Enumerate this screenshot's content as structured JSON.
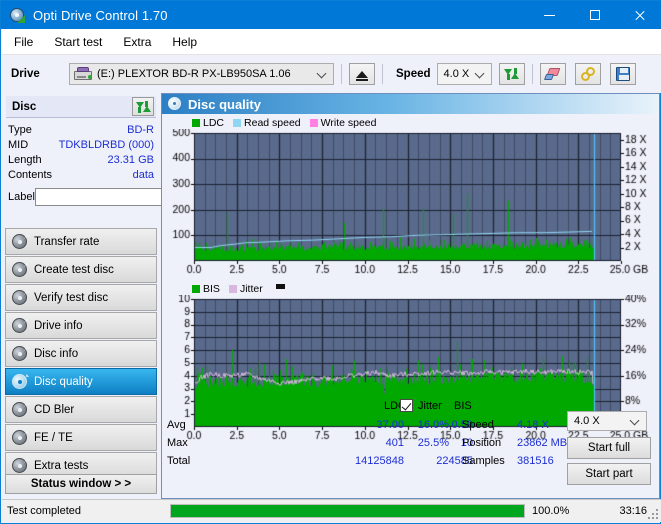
{
  "window": {
    "title": "Opti Drive Control 1.70",
    "icon": "disc-drive-icon",
    "minimize": "minimize",
    "maximize": "maximize",
    "close": "close"
  },
  "menu": {
    "items": [
      {
        "label": "File"
      },
      {
        "label": "Start test"
      },
      {
        "label": "Extra"
      },
      {
        "label": "Help"
      }
    ]
  },
  "toolbar": {
    "drive_label": "Drive",
    "drive_value": "(E:)   PLEXTOR BD-R  PX-LB950SA 1.06",
    "eject_label": "eject",
    "speed_label": "Speed",
    "speed_value": "4.0 X",
    "refresh_label": "refresh",
    "erase_label": "erase",
    "key_label": "key",
    "save_label": "save"
  },
  "disc": {
    "header": "Disc",
    "refresh_label": "refresh",
    "rows": [
      {
        "key": "Type",
        "value": "BD-R"
      },
      {
        "key": "MID",
        "value": "TDKBLDRBD (000)"
      },
      {
        "key": "Length",
        "value": "23.31 GB"
      },
      {
        "key": "Contents",
        "value": "data"
      }
    ],
    "label_key": "Label",
    "label_value": "",
    "label_placeholder": ""
  },
  "nav": {
    "items": [
      {
        "label": "Transfer rate",
        "active": false
      },
      {
        "label": "Create test disc",
        "active": false
      },
      {
        "label": "Verify test disc",
        "active": false
      },
      {
        "label": "Drive info",
        "active": false
      },
      {
        "label": "Disc info",
        "active": false
      },
      {
        "label": "Disc quality",
        "active": true
      },
      {
        "label": "CD Bler",
        "active": false
      },
      {
        "label": "FE / TE",
        "active": false
      },
      {
        "label": "Extra tests",
        "active": false
      }
    ],
    "status_window": "Status window > >"
  },
  "panel": {
    "title": "Disc quality",
    "icon": "disc-quality-icon"
  },
  "stats": {
    "col_ldc": "LDC",
    "col_bis": "BIS",
    "row_avg": "Avg",
    "row_max": "Max",
    "row_total": "Total",
    "ldc_avg": "37.00",
    "ldc_max": "401",
    "ldc_total": "14125848",
    "bis_avg": "0.59",
    "bis_max": "10",
    "bis_total": "224585",
    "jitter_label": "Jitter",
    "jitter_checked": true,
    "jitter_avg": "16.0%",
    "jitter_max": "25.5%",
    "speed_label": "Speed",
    "speed_value": "4.18 X",
    "position_label": "Position",
    "position_value": "23862 MB",
    "samples_label": "Samples",
    "samples_value": "381516",
    "speed_select": "4.0 X",
    "start_full": "Start full",
    "start_part": "Start part"
  },
  "statusbar": {
    "message": "Test completed",
    "progress_pct": "100.0%",
    "progress_value": 100,
    "elapsed": "33:16"
  },
  "colors": {
    "accent": "#0078d7",
    "plot_bg": "#5a6a8c",
    "grid": "#283040",
    "ldc": "#00a800",
    "bis": "#00a800",
    "read_speed": "#8fd6f2",
    "write_speed": "#ff80e0",
    "jitter": "#d9b8e0",
    "progress": "#00a61e",
    "value_text": "#1d2fd4"
  },
  "chart_data": [
    {
      "type": "area",
      "name": "quality-top-chart",
      "title": "",
      "xlabel": "GB",
      "ylabel": "LDC",
      "xlim": [
        0,
        25
      ],
      "ylim": [
        0,
        500
      ],
      "xticks": [
        "0.0",
        "2.5",
        "5.0",
        "7.5",
        "10.0",
        "12.5",
        "15.0",
        "17.5",
        "20.0",
        "22.5",
        "25.0 GB"
      ],
      "yticks": [
        "100",
        "200",
        "300",
        "400",
        "500"
      ],
      "y2ticks": [
        "2 X",
        "4 X",
        "6 X",
        "8 X",
        "10 X",
        "12 X",
        "14 X",
        "16 X",
        "18 X"
      ],
      "y2lim": [
        0,
        19
      ],
      "grid": true,
      "legend": [
        {
          "label": "LDC",
          "color": "#00a800"
        },
        {
          "label": "Read speed",
          "color": "#8fd6f2"
        },
        {
          "label": "Write speed",
          "color": "#ff80e0"
        }
      ],
      "data_end_x": 23.4,
      "series": [
        {
          "name": "LDC",
          "color": "#00a800",
          "type": "spike-area",
          "baseline": 45,
          "noise": 22,
          "values": [
            60,
            72,
            190,
            65,
            80,
            70,
            95,
            68,
            75,
            175,
            70,
            62,
            85,
            72,
            190,
            70,
            215,
            80,
            68,
            72,
            60,
            66,
            74,
            63,
            70,
            78,
            62,
            68,
            74,
            60,
            66,
            80,
            70,
            64,
            72,
            60,
            68,
            74,
            62,
            70,
            66,
            72,
            60,
            78,
            68,
            64,
            72,
            60,
            70,
            66,
            74,
            62,
            68,
            72,
            60,
            66,
            70,
            78,
            64,
            72,
            235,
            70,
            66,
            145,
            72,
            60,
            68,
            140,
            64,
            70,
            66,
            72,
            60,
            74,
            68,
            62,
            70,
            66,
            72,
            60,
            196,
            70,
            64,
            72,
            66,
            60,
            74,
            68,
            70,
            62,
            72,
            66,
            60,
            68,
            74,
            70,
            62,
            200,
            66,
            72,
            60,
            68,
            74,
            66,
            70,
            62,
            72,
            60,
            68,
            74,
            175,
            66,
            70,
            62,
            72,
            60,
            255,
            68,
            74,
            66,
            70,
            62,
            72,
            60,
            68,
            74,
            66,
            70,
            62,
            72,
            185,
            60,
            68,
            225,
            74,
            66,
            70,
            62,
            72,
            60,
            68,
            74,
            66,
            70,
            62,
            190,
            72,
            60,
            68,
            74,
            66,
            70,
            160,
            62,
            72,
            60,
            68,
            74,
            66,
            70,
            62,
            72,
            60,
            68,
            74,
            66,
            70,
            62,
            72,
            60
          ]
        },
        {
          "name": "Read speed",
          "color": "#8fd6f2",
          "type": "line",
          "points": [
            [
              0.0,
              2.0
            ],
            [
              1.0,
              2.0
            ],
            [
              1.6,
              2.3
            ],
            [
              2.4,
              2.5
            ],
            [
              3.0,
              2.7
            ],
            [
              4.0,
              2.8
            ],
            [
              5.5,
              3.0
            ],
            [
              7.0,
              3.1
            ],
            [
              8.5,
              3.3
            ],
            [
              10.0,
              3.5
            ],
            [
              11.5,
              3.6
            ],
            [
              13.0,
              3.8
            ],
            [
              14.5,
              3.9
            ],
            [
              16.0,
              4.0
            ],
            [
              17.5,
              4.1
            ],
            [
              19.0,
              4.2
            ],
            [
              20.5,
              4.2
            ],
            [
              22.0,
              4.3
            ],
            [
              23.3,
              4.4
            ]
          ]
        }
      ]
    },
    {
      "type": "area",
      "name": "quality-bottom-chart",
      "title": "",
      "xlabel": "GB",
      "ylabel": "BIS",
      "xlim": [
        0,
        25
      ],
      "ylim": [
        0,
        10
      ],
      "xticks": [
        "0.0",
        "2.5",
        "5.0",
        "7.5",
        "10.0",
        "12.5",
        "15.0",
        "17.5",
        "20.0",
        "22.5",
        "25.0 GB"
      ],
      "yticks": [
        "1",
        "2",
        "3",
        "4",
        "5",
        "6",
        "7",
        "8",
        "9",
        "10"
      ],
      "y2ticks": [
        "8%",
        "16%",
        "24%",
        "32%",
        "40%"
      ],
      "y2lim": [
        0,
        40
      ],
      "grid": true,
      "legend": [
        {
          "label": "BIS",
          "color": "#00a800"
        },
        {
          "label": "Jitter",
          "color": "#d9b8e0"
        }
      ],
      "data_end_x": 23.4,
      "series": [
        {
          "name": "BIS",
          "color": "#00a800",
          "type": "spike-area",
          "baseline": 3.4,
          "noise": 0.9,
          "values": [
            3.6,
            4.2,
            3.4,
            5.0,
            3.8,
            4.4,
            3.2,
            4.8,
            3.6,
            5.2,
            4.0,
            3.4,
            6.0,
            3.8,
            4.6,
            3.2,
            5.0,
            3.6,
            6.1,
            4.2,
            3.4,
            4.8,
            3.8,
            5.0,
            3.2,
            4.4,
            3.6,
            8.0,
            4.0,
            5.2,
            3.4,
            4.6,
            3.8,
            3.2,
            4.2,
            3.6,
            2.8,
            4.0,
            3.4,
            3.0,
            3.8,
            3.2,
            4.6,
            3.6,
            2.6,
            3.4,
            3.0,
            3.8,
            5.0,
            3.2,
            4.4,
            3.6,
            3.0,
            4.2,
            3.4,
            2.8,
            3.8,
            3.2,
            4.0,
            3.6,
            2.4,
            3.4,
            5.0,
            3.0,
            3.8,
            3.2,
            4.6,
            3.6,
            3.0,
            4.2,
            3.4,
            2.8,
            6.0,
            3.8,
            3.2,
            4.4,
            3.6,
            3.0,
            5.2,
            3.4,
            2.6,
            4.0,
            3.8,
            3.2,
            6.4,
            4.6,
            3.6,
            3.0,
            5.0,
            3.4,
            2.8,
            4.2,
            3.8,
            3.2,
            6.0,
            4.4,
            3.6,
            3.0,
            5.2,
            3.4,
            2.8,
            4.0,
            3.8,
            3.2,
            4.6,
            3.6,
            3.0,
            5.0,
            3.4,
            2.8,
            4.2,
            3.8,
            3.2,
            4.4,
            3.6,
            3.0,
            5.2,
            3.4,
            2.8,
            4.0,
            3.8,
            3.2,
            4.6,
            3.6,
            3.0,
            5.0,
            3.4,
            2.8
          ]
        },
        {
          "name": "Jitter",
          "color": "#d9b8e0",
          "type": "line",
          "points": [
            [
              0.0,
              13.5
            ],
            [
              0.4,
              15.5
            ],
            [
              1.0,
              16.5
            ],
            [
              2.0,
              16.0
            ],
            [
              3.0,
              16.5
            ],
            [
              4.0,
              15.0
            ],
            [
              5.0,
              13.8
            ],
            [
              5.8,
              14.0
            ],
            [
              6.6,
              14.5
            ],
            [
              7.4,
              15.5
            ],
            [
              8.2,
              15.0
            ],
            [
              9.0,
              16.0
            ],
            [
              10.0,
              16.5
            ],
            [
              10.6,
              17.0
            ],
            [
              11.4,
              16.0
            ],
            [
              12.4,
              16.5
            ],
            [
              13.4,
              16.8
            ],
            [
              14.4,
              17.2
            ],
            [
              15.4,
              17.0
            ],
            [
              16.4,
              16.8
            ],
            [
              17.4,
              17.2
            ],
            [
              18.4,
              17.0
            ],
            [
              19.4,
              17.4
            ],
            [
              20.4,
              17.0
            ],
            [
              21.4,
              17.4
            ],
            [
              22.4,
              17.2
            ],
            [
              23.3,
              17.0
            ]
          ]
        }
      ]
    }
  ]
}
